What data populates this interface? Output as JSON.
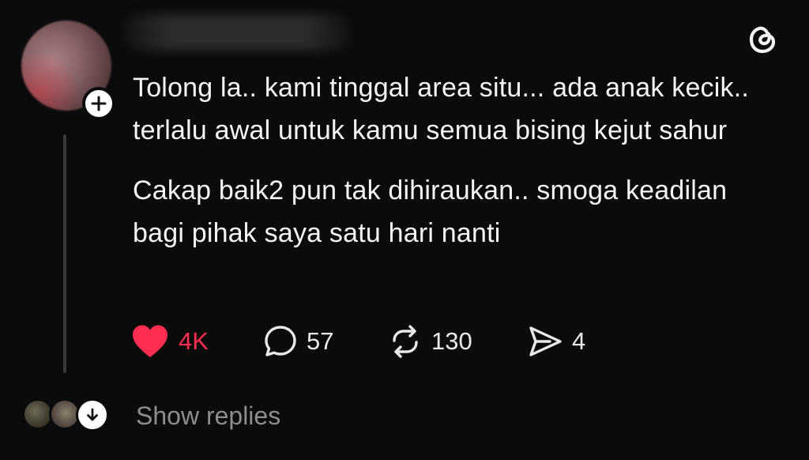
{
  "post": {
    "body": [
      "Tolong la.. kami tinggal area situ... ada anak kecik.. terlalu awal untuk kamu semua bising kejut sahur",
      "Cakap baik2 pun tak dihiraukan.. smoga keadilan bagi pihak saya satu hari nanti"
    ]
  },
  "actions": {
    "likes": "4K",
    "replies": "57",
    "reposts": "130",
    "shares": "4"
  },
  "replies_row": {
    "label": "Show replies"
  },
  "icons": {
    "brand": "threads-logo",
    "like": "heart-icon",
    "reply": "comment-icon",
    "repost": "repost-icon",
    "share": "send-icon",
    "expand": "arrow-down-icon",
    "follow": "plus-icon"
  },
  "colors": {
    "background": "#0b0b0b",
    "like_active": "#ff2d4f",
    "text": "#f4f4f4",
    "muted": "#8d8d8d"
  }
}
